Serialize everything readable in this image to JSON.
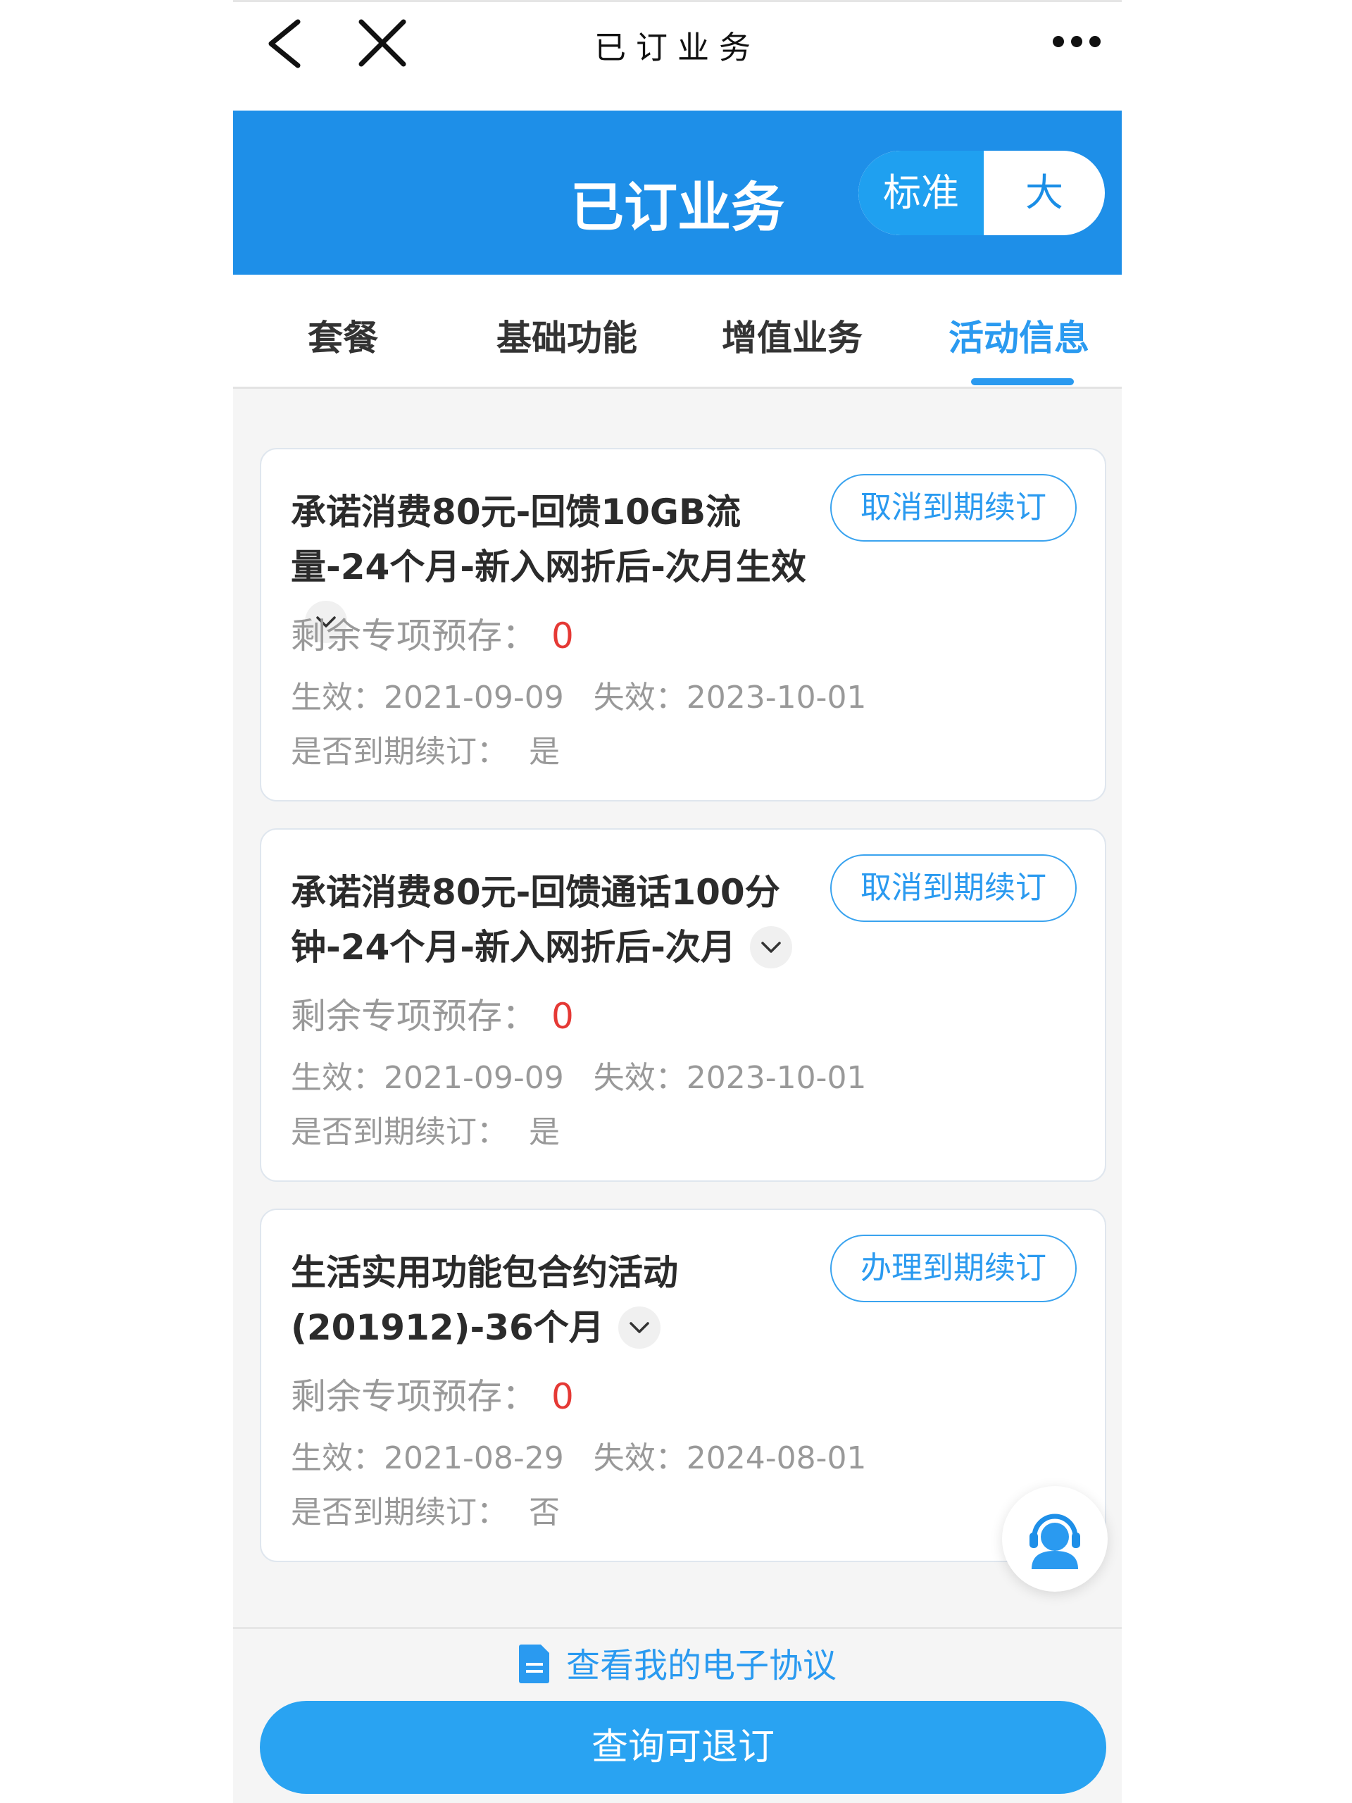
{
  "topbar": {
    "title": "已订业务"
  },
  "header": {
    "title": "已订业务",
    "toggle": {
      "standard": "标准",
      "large": "大",
      "selected": "标准"
    }
  },
  "tabs": [
    {
      "label": "套餐",
      "active": false
    },
    {
      "label": "基础功能",
      "active": false
    },
    {
      "label": "增值业务",
      "active": false
    },
    {
      "label": "活动信息",
      "active": true
    }
  ],
  "cards": [
    {
      "name": "承诺消费80元-回馈10GB流量-24个月-新入网折后-次月生效",
      "action": "取消到期续订",
      "remain_label": "剩余专项预存：",
      "remain_value": "0",
      "effective_label": "生效：",
      "effective": "2021-09-09",
      "expire_label": "失效：",
      "expire": "2023-10-01",
      "renew_label": "是否到期续订：",
      "renew": "是"
    },
    {
      "name": "承诺消费80元-回馈通话100分钟-24个月-新入网折后-次月",
      "action": "取消到期续订",
      "remain_label": "剩余专项预存：",
      "remain_value": "0",
      "effective_label": "生效：",
      "effective": "2021-09-09",
      "expire_label": "失效：",
      "expire": "2023-10-01",
      "renew_label": "是否到期续订：",
      "renew": "是"
    },
    {
      "name": "生活实用功能包合约活动(201912)-36个月",
      "action": "办理到期续订",
      "remain_label": "剩余专项预存：",
      "remain_value": "0",
      "effective_label": "生效：",
      "effective": "2021-08-29",
      "expire_label": "失效：",
      "expire": "2024-08-01",
      "renew_label": "是否到期续订：",
      "renew": "否"
    }
  ],
  "bottom": {
    "agreement_link": "查看我的电子协议",
    "query_button": "查询可退订"
  },
  "colors": {
    "brand": "#1e8fe8",
    "accent": "#2a9af0",
    "alert": "#e53935"
  },
  "icons": [
    "back-icon",
    "close-icon",
    "more-icon",
    "chevron-down-icon",
    "customer-service-icon",
    "document-icon"
  ]
}
